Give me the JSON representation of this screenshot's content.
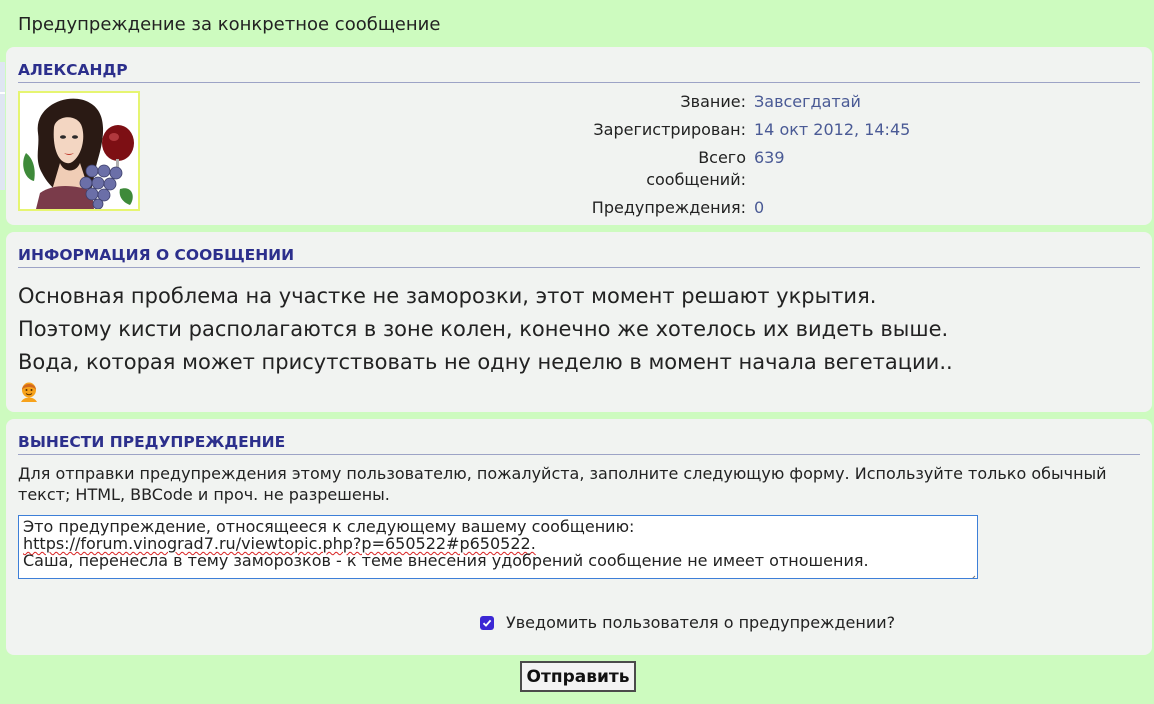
{
  "page": {
    "heading": "Предупреждение за конкретное сообщение"
  },
  "user_panel": {
    "username": "АЛЕКСАНДР",
    "rows": [
      {
        "key": "Звание:",
        "value": "Завсегдатай"
      },
      {
        "key": "Зарегистрирован:",
        "value": "14 окт 2012, 14:45"
      },
      {
        "key": "Всего сообщений:",
        "value": "639"
      },
      {
        "key": "Предупреждения:",
        "value": "0"
      }
    ]
  },
  "message_panel": {
    "title": "ИНФОРМАЦИЯ О СООБЩЕНИИ",
    "lines": [
      "Основная проблема на участке не заморозки, этот момент решают укрытия.",
      "Поэтому кисти располагаются в зоне колен, конечно же хотелось их видеть выше.",
      "Вода, которая может присутствовать не одну неделю в момент начала вегетации.."
    ],
    "emoji": "smiley-icon"
  },
  "warn_panel": {
    "title": "ВЫНЕСТИ ПРЕДУПРЕЖДЕНИЕ",
    "description": "Для отправки предупреждения этому пользователю, пожалуйста, заполните следующую форму. Используйте только обычный текст; HTML, BBCode и проч. не разрешены.",
    "textarea_line1": "Это предупреждение, относящееся к следующему вашему сообщению:",
    "textarea_line2": "https://forum.vinograd7.ru/viewtopic.php?p=650522#p650522.",
    "textarea_line3": "Саша, перенесла в тему заморозков - к теме внесения удобрений сообщение не имеет отношения.",
    "notify_label": "Уведомить пользователя о предупреждении?",
    "notify_checked": true
  },
  "submit": {
    "label": "Отправить"
  },
  "colors": {
    "background": "#cdfbbf",
    "panel": "#f1f3f1",
    "title": "#2c2f8c",
    "value": "#4a5a95",
    "checkbox": "#3b27d4"
  }
}
